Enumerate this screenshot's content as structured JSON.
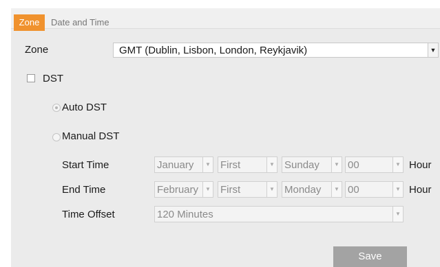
{
  "tabs": [
    {
      "label": "Zone"
    },
    {
      "label": "Date and Time"
    }
  ],
  "zone": {
    "label": "Zone",
    "selected": "GMT (Dublin, Lisbon, London, Reykjavik)"
  },
  "dst": {
    "label": "DST",
    "checked": false,
    "auto_label": "Auto DST",
    "manual_label": "Manual DST",
    "mode": "Auto DST"
  },
  "start_time": {
    "label": "Start Time",
    "month": "January",
    "week": "First",
    "day": "Sunday",
    "hour": "00",
    "unit": "Hour"
  },
  "end_time": {
    "label": "End Time",
    "month": "February",
    "week": "First",
    "day": "Monday",
    "hour": "00",
    "unit": "Hour"
  },
  "time_offset": {
    "label": "Time Offset",
    "value": "120 Minutes"
  },
  "save_label": "Save",
  "icons": {
    "dropdown": "chevron-down-icon",
    "checkbox": "checkbox-icon",
    "radio": "radio-icon"
  },
  "colors": {
    "active_tab": "#f0922e",
    "panel_bg": "#ebebeb",
    "save_button": "#a3a3a3"
  }
}
